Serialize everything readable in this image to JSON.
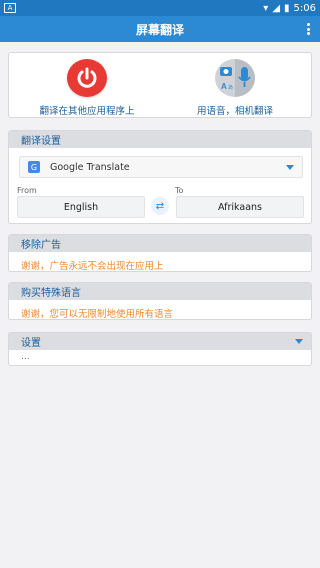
{
  "status_bar": {
    "time": "5:06",
    "left_icon_text": "A"
  },
  "app": {
    "title": "屏幕翻译"
  },
  "hero": {
    "left_caption": "翻译在其他应用程序上",
    "right_caption": "用语音，相机翻译"
  },
  "translation_settings": {
    "header": "翻译设置",
    "engine": "Google Translate",
    "from_label": "From",
    "to_label": "To",
    "from_value": "English",
    "to_value": "Afrikaans"
  },
  "remove_ads": {
    "header": "移除广告",
    "message": "谢谢，广告永远不会出现在应用上"
  },
  "buy_languages": {
    "header": "购买特殊语言",
    "message": "谢谢，您可以无限制地使用所有语言"
  },
  "settings": {
    "header": "设置",
    "value": "..."
  },
  "colors": {
    "primary": "#2b8ad3",
    "accent": "#e83a35",
    "notice": "#f08a2a"
  },
  "icons": {
    "menu": "overflow-icon",
    "power": "power-icon",
    "camera": "camera-icon",
    "mic": "microphone-icon",
    "swap": "swap-icon",
    "gt": "google-translate-icon"
  }
}
